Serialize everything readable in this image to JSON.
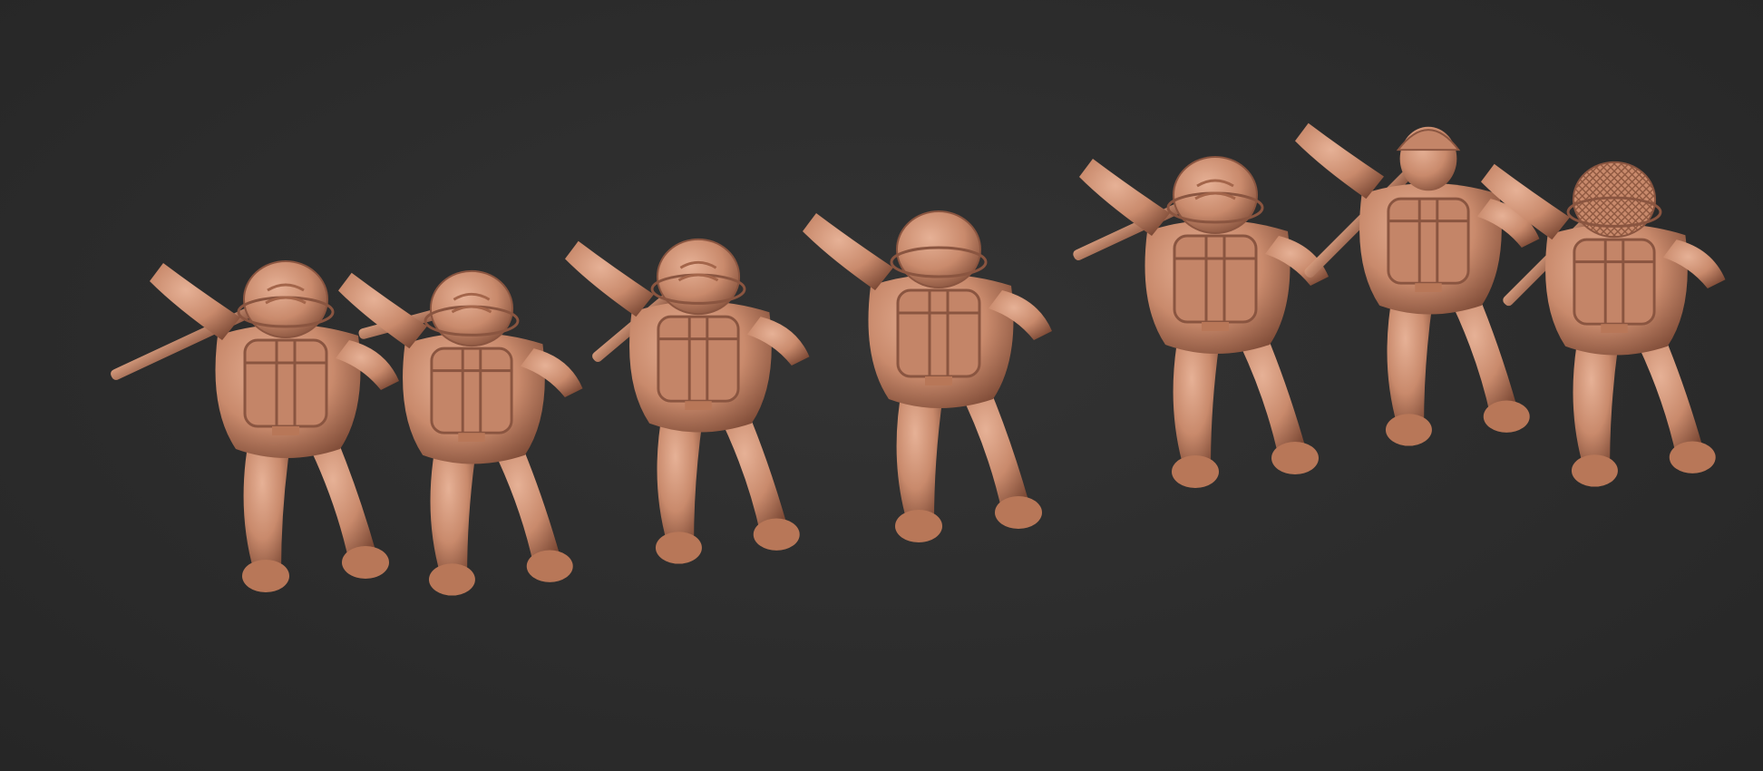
{
  "scene": {
    "background_color": "#2c2c2c",
    "material_color": "#c98a6c",
    "figure_count": 7,
    "figures": [
      {
        "name": "soldier-1",
        "helmet": "ribbed",
        "pose": "aiming-left"
      },
      {
        "name": "soldier-2",
        "helmet": "ribbed",
        "pose": "aiming-left"
      },
      {
        "name": "soldier-3",
        "helmet": "ribbed",
        "pose": "rifle-shoulder"
      },
      {
        "name": "soldier-4",
        "helmet": "smooth",
        "pose": "running"
      },
      {
        "name": "soldier-5",
        "helmet": "ribbed",
        "pose": "aiming-up"
      },
      {
        "name": "soldier-6",
        "helmet": "garrison-cap",
        "pose": "aiming-up"
      },
      {
        "name": "soldier-7",
        "helmet": "netted",
        "pose": "aiming-up"
      }
    ]
  }
}
